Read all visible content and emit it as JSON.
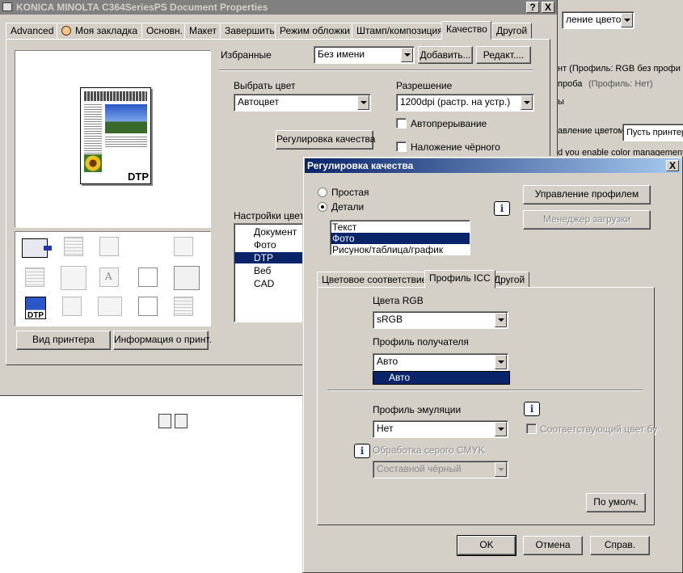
{
  "main_window": {
    "title": "KONICA MINOLTA C364SeriesPS Document Properties",
    "help_btn": "?",
    "close_btn": "X",
    "tabs": [
      "Advanced",
      "Моя закладка",
      "Основн.",
      "Макет",
      "Завершить",
      "Режим обложки",
      "Штамп/композиция",
      "Качество",
      "Другой"
    ],
    "favorites_label": "Избранные",
    "favorites_value": "Без имени",
    "add_btn": "Добавить...",
    "edit_btn": "Редакт....",
    "select_color_label": "Выбрать цвет",
    "select_color_value": "Автоцвет",
    "resolution_label": "Разрешение",
    "resolution_value": "1200dpi (растр. на устр.)",
    "auto_trapping": "Автопрерывание",
    "black_overprint": "Наложение чёрного",
    "quality_adjust_btn": "Регулировка качества",
    "color_settings_label": "Настройки цвета",
    "color_settings_items": [
      "Документ",
      "Фото",
      "DTP",
      "Веб",
      "CAD"
    ],
    "color_settings_selected": "DTP",
    "preview_tag": "DTP",
    "printer_view_btn": "Вид принтера",
    "printer_info_btn": "Информация о принт."
  },
  "background_window": {
    "combo_value": "ление цветом",
    "line1": "нт  (Профиль: RGB без профи",
    "line2_prefix": "проба",
    "line2_suffix": "(Профиль: Нет)",
    "line3": "ы",
    "mgmt_label": "авление цветом:",
    "mgmt_value": "Пусть принтер",
    "line4": "d you enable color management"
  },
  "dialog": {
    "title": "Регулировка качества",
    "close_btn": "X",
    "mode_simple": "Простая",
    "mode_detail": "Детали",
    "profile_mgmt_btn": "Управление профилем",
    "download_mgr_btn": "Менеджер загрузки",
    "object_list": [
      "Текст",
      "Фото",
      "Рисунок/таблица/график"
    ],
    "object_selected": "Фото",
    "tabs": [
      "Цветовое соответствие",
      "Профиль ICC",
      "Другой"
    ],
    "active_tab": "Профиль ICC",
    "rgb_colors_label": "Цвета RGB",
    "rgb_colors_value": "sRGB",
    "dest_profile_label": "Профиль получателя",
    "dest_profile_value": "Авто",
    "dest_profile_dropdown_option": "Авто",
    "emulation_label": "Профиль эмуляции",
    "emulation_value": "Нет",
    "matching_color_label": "Соответствующий цвет бу",
    "gray_cmyk_label": "Обработка серого CMYK",
    "gray_cmyk_value": "Составной чёрный",
    "defaults_btn": "По умолч.",
    "ok_btn": "OK",
    "cancel_btn": "Отмена",
    "help_btn": "Справ."
  },
  "colors": {
    "dialog_title_start": "#0a246a",
    "dialog_title_end": "#a6caf0",
    "inactive_title": "#808080",
    "selection": "#0a246a",
    "face": "#d4d0c8",
    "info_icon": "#1a3aa8"
  }
}
